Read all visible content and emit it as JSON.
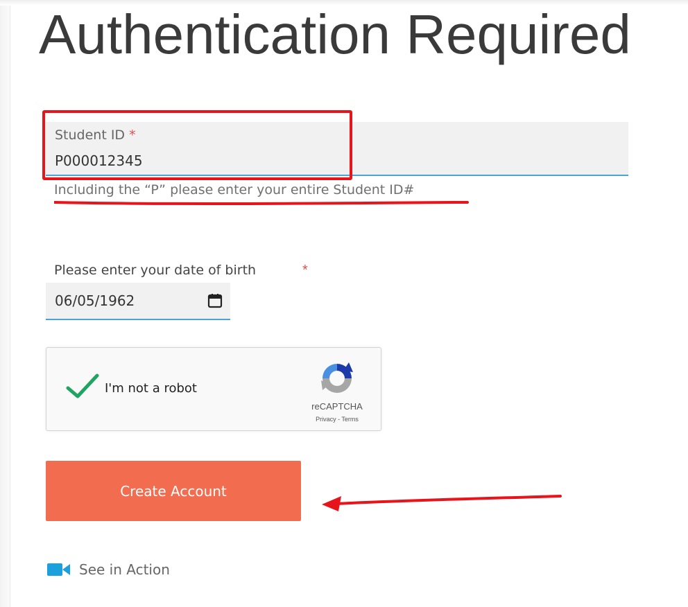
{
  "page": {
    "title": "Authentication Required"
  },
  "student_id": {
    "label": "Student ID",
    "required_mark": "*",
    "value": "P000012345",
    "hint": "Including the “P” please enter your entire Student ID#"
  },
  "dob": {
    "label": "Please enter your date of birth",
    "required_mark": "*",
    "value": "06/05/1962"
  },
  "recaptcha": {
    "label": "I'm not a robot",
    "checked": true,
    "brand": "reCAPTCHA",
    "links": "Privacy - Terms"
  },
  "actions": {
    "create_account_label": "Create Account",
    "see_in_action_label": "See in Action"
  },
  "icons": {
    "calendar": "calendar-icon",
    "check": "checkmark-icon",
    "recaptcha": "recaptcha-logo-icon",
    "video": "video-camera-icon"
  },
  "colors": {
    "accent_button": "#f26c4f",
    "field_underline": "#4aa3d6",
    "required": "#d9534f",
    "annotation": "#e8141b",
    "check": "#1fa463",
    "video_icon": "#1aa0dc"
  }
}
